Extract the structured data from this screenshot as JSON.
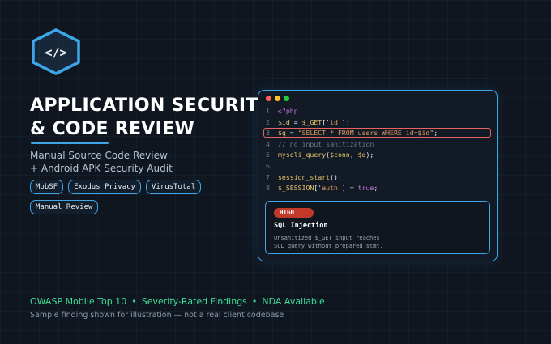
{
  "logo": {
    "icon": "code-shield-icon",
    "text": "</>"
  },
  "title": {
    "line1": "APPLICATION SECURITY",
    "line2": "& CODE REVIEW"
  },
  "subtitle": {
    "line1": "Manual Source Code Review",
    "line2": "+ Android APK Security Audit"
  },
  "badges": [
    "MobSF",
    "Exodus Privacy",
    "VirusTotal",
    "Manual Review"
  ],
  "code_window": {
    "dots": [
      "#ff5f56",
      "#ffbd2e",
      "#27c93f"
    ],
    "highlighted_line": 3,
    "lines": [
      {
        "n": "1",
        "tokens": [
          [
            "kw",
            "<?php"
          ]
        ]
      },
      {
        "n": "2",
        "tokens": [
          [
            "var",
            "$id"
          ],
          [
            "pl",
            " = "
          ],
          [
            "var",
            "$_GET"
          ],
          [
            "pl",
            "['"
          ],
          [
            "str",
            "id"
          ],
          [
            "pl",
            "'];"
          ]
        ]
      },
      {
        "n": "3",
        "tokens": [
          [
            "var",
            "$q"
          ],
          [
            "pl",
            " = "
          ],
          [
            "str",
            "\"SELECT * FROM users WHERE id=$id\""
          ],
          [
            "pl",
            ";"
          ]
        ]
      },
      {
        "n": "4",
        "tokens": [
          [
            "cmt",
            "// no input sanitization"
          ]
        ]
      },
      {
        "n": "5",
        "tokens": [
          [
            "fn",
            "mysqli_query"
          ],
          [
            "pl",
            "("
          ],
          [
            "var",
            "$conn"
          ],
          [
            "pl",
            ", "
          ],
          [
            "var",
            "$q"
          ],
          [
            "pl",
            ");"
          ]
        ]
      },
      {
        "n": "6",
        "tokens": []
      },
      {
        "n": "7",
        "tokens": [
          [
            "fn",
            "session_start"
          ],
          [
            "pl",
            "();"
          ]
        ]
      },
      {
        "n": "8",
        "tokens": [
          [
            "var",
            "$_SESSION"
          ],
          [
            "pl",
            "['"
          ],
          [
            "str",
            "auth"
          ],
          [
            "pl",
            "'] = "
          ],
          [
            "kw",
            "true"
          ],
          [
            "pl",
            ";"
          ]
        ]
      }
    ]
  },
  "finding": {
    "severity": "HIGH",
    "severity_color": "#c0392b",
    "title": "SQL Injection",
    "desc_line1": "Unsanitized $_GET input reaches",
    "desc_line2": "SQL query without prepared stmt."
  },
  "features": [
    "OWASP Mobile Top 10",
    "Severity-Rated Findings",
    "NDA Available"
  ],
  "feature_separator": "•",
  "disclaimer": "Sample finding shown for illustration — not a real client codebase",
  "colors": {
    "accent": "#3ea6e8",
    "green": "#3ddc97",
    "background": "#0f1620",
    "highlight": "#e8625f"
  }
}
